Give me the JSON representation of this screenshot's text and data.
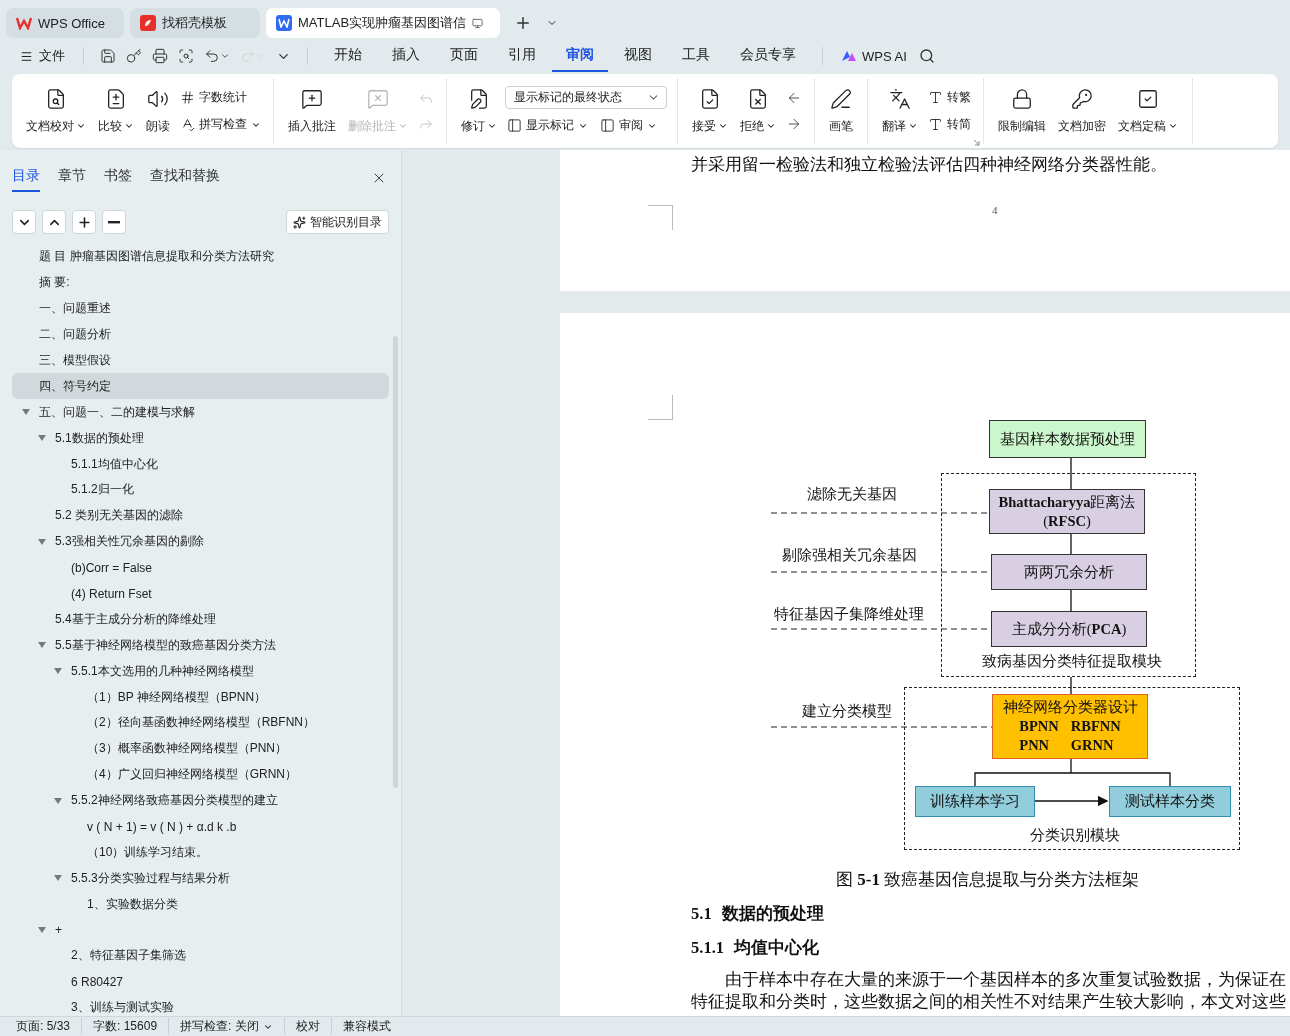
{
  "title_tabs": [
    {
      "kind": "wps",
      "label": "WPS Office",
      "selected": false
    },
    {
      "kind": "template",
      "label": "找稻壳模板",
      "selected": false
    },
    {
      "kind": "doc",
      "label": "MATLAB实现肿瘤基因图谱信",
      "selected": true
    }
  ],
  "menu": {
    "file": "文件",
    "quick_actions": [
      {
        "disabled": false,
        "dropdown": false
      },
      {
        "disabled": false,
        "dropdown": false
      },
      {
        "disabled": false,
        "dropdown": false
      },
      {
        "disabled": false,
        "dropdown": false
      },
      {
        "disabled": false,
        "dropdown": true
      },
      {
        "disabled": true,
        "dropdown": true
      },
      {
        "disabled": false,
        "dropdown": true
      }
    ],
    "tabs": [
      {
        "label": "开始",
        "selected": false
      },
      {
        "label": "插入",
        "selected": false
      },
      {
        "label": "页面",
        "selected": false
      },
      {
        "label": "引用",
        "selected": false
      },
      {
        "label": "审阅",
        "selected": true
      },
      {
        "label": "视图",
        "selected": false
      },
      {
        "label": "工具",
        "selected": false
      },
      {
        "label": "会员专享",
        "selected": false
      }
    ],
    "ai": "WPS AI"
  },
  "ribbon": [
    {
      "items": [
        {
          "kind": "large",
          "label": "文档校对",
          "dropdown": true,
          "disabled": false
        },
        {
          "kind": "large",
          "label": "比较",
          "dropdown": true,
          "disabled": false
        },
        {
          "kind": "large",
          "label": "朗读",
          "dropdown": false,
          "disabled": false
        },
        {
          "kind": "stack",
          "rows": [
            [
              {
                "kind": "small",
                "label": "字数统计",
                "dropdown": false,
                "disabled": false
              }
            ],
            [
              {
                "kind": "small",
                "label": "拼写检查",
                "dropdown": true,
                "disabled": false
              }
            ]
          ]
        }
      ]
    },
    {
      "items": [
        {
          "kind": "large",
          "label": "插入批注",
          "dropdown": false,
          "disabled": false
        },
        {
          "kind": "large",
          "label": "删除批注",
          "dropdown": true,
          "disabled": true
        },
        {
          "kind": "stack",
          "rows": [
            [
              {
                "kind": "icon",
                "disabled": true
              }
            ],
            [
              {
                "kind": "icon",
                "disabled": true
              }
            ]
          ]
        }
      ]
    },
    {
      "items": [
        {
          "kind": "large",
          "label": "修订",
          "dropdown": true,
          "disabled": false
        },
        {
          "kind": "stack",
          "rows": [
            [
              {
                "kind": "select",
                "value": "显示标记的最终状态"
              }
            ],
            [
              {
                "kind": "small",
                "label": "显示标记",
                "dropdown": true,
                "disabled": false
              },
              {
                "kind": "small",
                "label": "审阅",
                "dropdown": true,
                "disabled": false
              }
            ]
          ]
        }
      ]
    },
    {
      "items": [
        {
          "kind": "large",
          "label": "接受",
          "dropdown": true,
          "disabled": false
        },
        {
          "kind": "large",
          "label": "拒绝",
          "dropdown": true,
          "disabled": false
        },
        {
          "kind": "stack",
          "rows": [
            [
              {
                "kind": "icon",
                "disabled": false
              }
            ],
            [
              {
                "kind": "icon",
                "disabled": false
              }
            ]
          ]
        }
      ]
    },
    {
      "items": [
        {
          "kind": "large",
          "label": "画笔",
          "dropdown": false,
          "disabled": false
        }
      ]
    },
    {
      "items": [
        {
          "kind": "large",
          "label": "翻译",
          "dropdown": true,
          "disabled": false
        },
        {
          "kind": "stack",
          "rows": [
            [
              {
                "kind": "small",
                "label": "转繁",
                "dropdown": false,
                "disabled": false
              }
            ],
            [
              {
                "kind": "small",
                "label": "转简",
                "dropdown": false,
                "disabled": false
              }
            ]
          ]
        }
      ]
    },
    {
      "items": [
        {
          "kind": "large",
          "label": "限制编辑",
          "dropdown": false,
          "disabled": false
        },
        {
          "kind": "large",
          "label": "文档加密",
          "dropdown": false,
          "disabled": false
        },
        {
          "kind": "large",
          "label": "文档定稿",
          "dropdown": true,
          "disabled": false
        }
      ]
    }
  ],
  "nav": {
    "tabs": [
      {
        "label": "目录",
        "selected": true
      },
      {
        "label": "章节",
        "selected": false
      },
      {
        "label": "书签",
        "selected": false
      },
      {
        "label": "查找和替换",
        "selected": false
      }
    ],
    "smart_button": "智能识别目录",
    "outline": [
      {
        "text": "题 目  肿瘤基因图谱信息提取和分类方法研究",
        "selected": false
      },
      {
        "text": "摘  要:",
        "selected": false
      },
      {
        "text": "一、问题重述",
        "selected": false
      },
      {
        "text": "二、问题分析",
        "selected": false
      },
      {
        "text": "三、模型假设",
        "selected": false
      },
      {
        "text": "四、符号约定",
        "selected": true
      },
      {
        "text": "五、问题一、二的建模与求解",
        "selected": false,
        "expanded": true,
        "children": [
          {
            "text": "5.1数据的预处理",
            "selected": false,
            "expanded": true,
            "children": [
              {
                "text": "5.1.1均值中心化",
                "selected": false
              },
              {
                "text": "5.1.2归一化",
                "selected": false
              }
            ]
          },
          {
            "text": "5.2 类别无关基因的滤除",
            "selected": false
          },
          {
            "text": "5.3强相关性冗余基因的剔除",
            "selected": false,
            "expanded": true,
            "children": [
              {
                "text": "(b)Corr = False",
                "selected": false
              },
              {
                "text": "(4) Return Fset",
                "selected": false
              }
            ]
          },
          {
            "text": "5.4基于主成分分析的降维处理",
            "selected": false
          },
          {
            "text": "5.5基于神经网络模型的致癌基因分类方法",
            "selected": false,
            "expanded": true,
            "children": [
              {
                "text": "5.5.1本文选用的几种神经网络模型",
                "selected": false,
                "expanded": true,
                "children": [
                  {
                    "text": "（1）BP 神经网络模型（BPNN）",
                    "selected": false
                  },
                  {
                    "text": "（2）径向基函数神经网络模型（RBFNN）",
                    "selected": false
                  },
                  {
                    "text": "（3）概率函数神经网络模型（PNN）",
                    "selected": false
                  },
                  {
                    "text": "（4）广义回归神经网络模型（GRNN）",
                    "selected": false
                  }
                ]
              },
              {
                "text": "5.5.2神经网络致癌基因分类模型的建立",
                "selected": false,
                "expanded": true,
                "children": [
                  {
                    "text": "v ( N + 1) = v ( N ) + α.d k .b",
                    "selected": false
                  },
                  {
                    "text": "（10）训练学习结束。",
                    "selected": false
                  }
                ]
              },
              {
                "text": "5.5.3分类实验过程与结果分析",
                "selected": false,
                "expanded": true,
                "children": [
                  {
                    "text": "1、实验数据分类",
                    "selected": false
                  }
                ]
              }
            ]
          },
          {
            "text": "+",
            "selected": false,
            "expanded": true,
            "children": [
              {
                "text": "2、特征基因子集筛选",
                "selected": false
              },
              {
                "text": "6  R80427",
                "selected": false
              },
              {
                "text": "3、训练与测试实验",
                "selected": false
              }
            ]
          }
        ]
      }
    ]
  },
  "pages": [
    {
      "lines": [
        "并采用留一检验法和独立检验法评估四种神经网络分类器性能。"
      ],
      "page_number": "4"
    }
  ],
  "diagram": {
    "nodes": [
      {
        "kind": "input",
        "text": "基因样本数据预处理"
      },
      {
        "kind": "feature",
        "text": "**Bhattacharyya**距离法(**RFSC**)"
      },
      {
        "kind": "feature",
        "text": "两两冗余分析"
      },
      {
        "kind": "feature",
        "text": "主成分分析(**PCA**)"
      },
      {
        "kind": "classifier",
        "text": "神经网络分类器设计",
        "models": [
          "BPNN",
          "RBFNN",
          "PNN",
          "GRNN"
        ]
      },
      {
        "kind": "sample",
        "text": "训练样本学习"
      },
      {
        "kind": "sample",
        "text": "测试样本分类"
      }
    ],
    "side_labels": [
      "滤除无关基因",
      "剔除强相关冗余基因",
      "特征基因子集降维处理",
      "建立分类模型"
    ],
    "modules": [
      "致病基因分类特征提取模块",
      "分类识别模块"
    ]
  },
  "caption": "图 **5-1**  致癌基因信息提取与分类方法框架",
  "headings": [
    {
      "number": "5.1",
      "text": "数据的预处理"
    },
    {
      "number": "5.1.1",
      "text": "均值中心化"
    }
  ],
  "paragraph": [
    "由于样本中存在大量的来源于一个基因样本的多次重复试验数据，为保证在",
    "特征提取和分类时，这些数据之间的相关性不对结果产生较大影响，本文对这些"
  ],
  "status_bar": {
    "page": "页面: 5/33",
    "words": "字数: 15609",
    "spell": "拼写检查: 关闭",
    "proof": "校对",
    "mode": "兼容模式"
  }
}
